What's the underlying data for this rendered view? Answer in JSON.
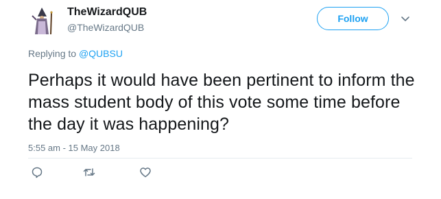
{
  "user": {
    "display_name": "TheWizardQUB",
    "handle": "@TheWizardQUB"
  },
  "follow_label": "Follow",
  "reply_context": {
    "prefix": "Replying to ",
    "mention": "@QUBSU"
  },
  "tweet": {
    "text": "Perhaps it would have been pertinent to inform the mass student body of this vote some time before the day it was happening?",
    "timestamp": "5:55 am - 15 May 2018"
  },
  "icons": [
    "avatar-wizard-icon",
    "chevron-down-icon",
    "reply-icon",
    "retweet-icon",
    "like-icon"
  ],
  "colors": {
    "accent": "#1da1f2",
    "muted": "#657786",
    "text": "#14171a"
  }
}
